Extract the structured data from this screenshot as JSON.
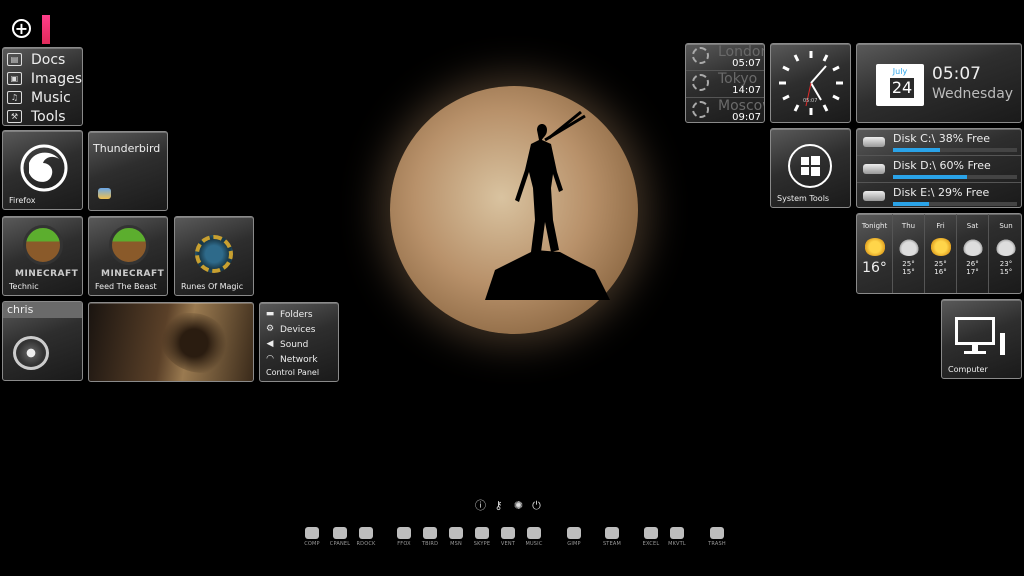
{
  "colors": {
    "accent": "#e02a5a",
    "disk_bar": "#2aa3e8",
    "background": "#000000"
  },
  "launcher": {
    "docs": [
      {
        "label": "Docs",
        "icon": "folder-icon"
      },
      {
        "label": "Images",
        "icon": "image-icon"
      },
      {
        "label": "Music",
        "icon": "music-icon"
      },
      {
        "label": "Tools",
        "icon": "toolbox-icon"
      }
    ]
  },
  "tiles": {
    "firefox": "Firefox",
    "thunderbird": "Thunderbird",
    "technic": "Technic",
    "feed_the_beast": "Feed The Beast",
    "runes_of_magic": "Runes Of Magic",
    "user": "chris",
    "system_tools": "System Tools",
    "computer": "Computer",
    "minecraft_logo": "MINECRAFT"
  },
  "control_panel": {
    "title": "Control Panel",
    "items": [
      {
        "label": "Folders",
        "icon": "folder-icon"
      },
      {
        "label": "Devices",
        "icon": "gear-icon"
      },
      {
        "label": "Sound",
        "icon": "speaker-icon"
      },
      {
        "label": "Network",
        "icon": "wifi-icon"
      }
    ]
  },
  "world_clock": [
    {
      "city": "London",
      "time": "05:07"
    },
    {
      "city": "Tokyo",
      "time": "14:07"
    },
    {
      "city": "Moscow",
      "time": "09:07"
    }
  ],
  "analog_clock": {
    "label": "05:07"
  },
  "calendar": {
    "month": "July",
    "day": "24",
    "time": "05:07",
    "weekday": "Wednesday"
  },
  "disks": [
    {
      "label": "Disk C:\\ 38% Free",
      "free": 0.38
    },
    {
      "label": "Disk D:\\ 60% Free",
      "free": 0.6
    },
    {
      "label": "Disk E:\\ 29% Free",
      "free": 0.29
    }
  ],
  "weather": {
    "tonight": {
      "label": "Tonight",
      "temp": "16°",
      "icon": "sun"
    },
    "days": [
      {
        "day": "Thu",
        "hi": "25°",
        "lo": "15°",
        "icon": "cloud"
      },
      {
        "day": "Fri",
        "hi": "25°",
        "lo": "16°",
        "icon": "sun"
      },
      {
        "day": "Sat",
        "hi": "26°",
        "lo": "17°",
        "icon": "cloud"
      },
      {
        "day": "Sun",
        "hi": "23°",
        "lo": "15°",
        "icon": "cloud"
      }
    ]
  },
  "system_icons": [
    "info-icon",
    "key-icon",
    "sleep-icon",
    "power-icon"
  ],
  "dock": [
    {
      "label": "COMP"
    },
    {
      "label": "CPANEL"
    },
    {
      "label": "RDOCK"
    },
    {
      "label": "FFOX"
    },
    {
      "label": "TBIRD"
    },
    {
      "label": "MSN"
    },
    {
      "label": "SKYPE"
    },
    {
      "label": "VENT"
    },
    {
      "label": "MUSIC"
    },
    {
      "label": "GIMP"
    },
    {
      "label": "STEAM"
    },
    {
      "label": "EXCEL"
    },
    {
      "label": "MKVTL"
    },
    {
      "label": "TRASH"
    }
  ]
}
